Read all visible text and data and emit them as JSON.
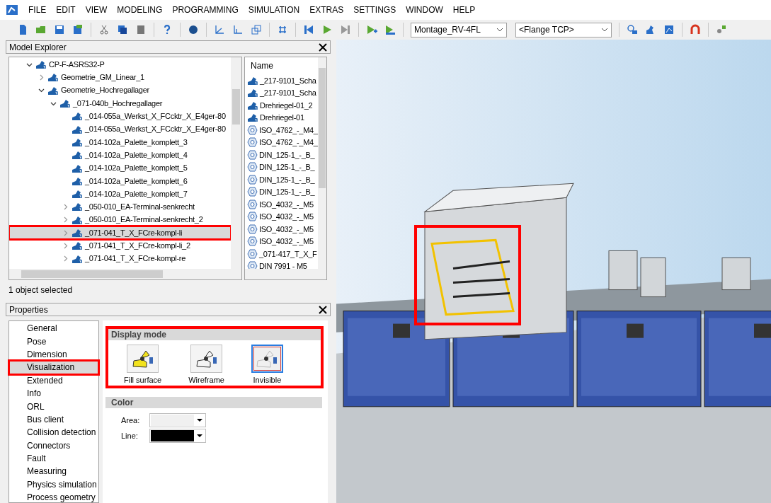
{
  "menu": [
    "FILE",
    "EDIT",
    "VIEW",
    "MODELING",
    "PROGRAMMING",
    "SIMULATION",
    "EXTRAS",
    "SETTINGS",
    "WINDOW",
    "HELP"
  ],
  "toolbar": {
    "robot_select": "Montage_RV-4FL",
    "tcp_select": "<Flange TCP>"
  },
  "model_explorer": {
    "title": "Model Explorer",
    "tree": [
      {
        "label": "CP-F-ASRS32-P",
        "kind": "group",
        "expanded": true,
        "selected": false,
        "children": [
          {
            "label": "Geometrie_GM_Linear_1",
            "kind": "group",
            "expanded": false,
            "selected": false
          },
          {
            "label": "Geometrie_Hochregallager",
            "kind": "group",
            "expanded": true,
            "selected": false,
            "children": [
              {
                "label": "_071-040b_Hochregallager",
                "kind": "group",
                "expanded": true,
                "selected": false,
                "children": [
                  {
                    "label": "_014-055a_Werkst_X_FCcktr_X_E4ger-80",
                    "kind": "leaf",
                    "selected": false
                  },
                  {
                    "label": "_014-055a_Werkst_X_FCcktr_X_E4ger-80",
                    "kind": "leaf",
                    "selected": false
                  },
                  {
                    "label": "_014-102a_Palette_komplett_3",
                    "kind": "leaf",
                    "selected": false
                  },
                  {
                    "label": "_014-102a_Palette_komplett_4",
                    "kind": "leaf",
                    "selected": false
                  },
                  {
                    "label": "_014-102a_Palette_komplett_5",
                    "kind": "leaf",
                    "selected": false
                  },
                  {
                    "label": "_014-102a_Palette_komplett_6",
                    "kind": "leaf",
                    "selected": false
                  },
                  {
                    "label": "_014-102a_Palette_komplett_7",
                    "kind": "leaf",
                    "selected": false
                  },
                  {
                    "label": "_050-010_EA-Terminal-senkrecht",
                    "kind": "group",
                    "expanded": false,
                    "selected": false
                  },
                  {
                    "label": "_050-010_EA-Terminal-senkrecht_2",
                    "kind": "group",
                    "expanded": false,
                    "selected": false
                  },
                  {
                    "label": "_071-041_T_X_FCre-kompl-li",
                    "kind": "group",
                    "expanded": false,
                    "selected": true
                  },
                  {
                    "label": "_071-041_T_X_FCre-kompl-li_2",
                    "kind": "group",
                    "expanded": false,
                    "selected": false
                  },
                  {
                    "label": "_071-041_T_X_FCre-kompl-re",
                    "kind": "group",
                    "expanded": false,
                    "selected": false
                  }
                ]
              }
            ]
          }
        ]
      }
    ],
    "list_header": "Name",
    "list": [
      {
        "label": "_217-9101_Scha",
        "kind": "part"
      },
      {
        "label": "_217-9101_Scha",
        "kind": "part"
      },
      {
        "label": "Drehriegel-01_2",
        "kind": "part"
      },
      {
        "label": "Drehriegel-01",
        "kind": "part"
      },
      {
        "label": "ISO_4762_-_M4_",
        "kind": "screw"
      },
      {
        "label": "ISO_4762_-_M4_",
        "kind": "screw"
      },
      {
        "label": "DIN_125-1_-_B_",
        "kind": "screw"
      },
      {
        "label": "DIN_125-1_-_B_",
        "kind": "screw"
      },
      {
        "label": "DIN_125-1_-_B_",
        "kind": "screw"
      },
      {
        "label": "DIN_125-1_-_B_",
        "kind": "screw"
      },
      {
        "label": "ISO_4032_-_M5",
        "kind": "screw"
      },
      {
        "label": "ISO_4032_-_M5",
        "kind": "screw"
      },
      {
        "label": "ISO_4032_-_M5",
        "kind": "screw"
      },
      {
        "label": "ISO_4032_-_M5",
        "kind": "screw"
      },
      {
        "label": "_071-417_T_X_F",
        "kind": "screw"
      },
      {
        "label": "DIN 7991 - M5",
        "kind": "screw"
      }
    ],
    "status": "1 object selected"
  },
  "properties": {
    "title": "Properties",
    "categories": [
      {
        "label": "General",
        "selected": false
      },
      {
        "label": "Pose",
        "selected": false
      },
      {
        "label": "Dimension",
        "selected": false
      },
      {
        "label": "Visualization",
        "selected": true
      },
      {
        "label": "Extended",
        "selected": false
      },
      {
        "label": "Info",
        "selected": false
      },
      {
        "label": "ORL",
        "selected": false
      },
      {
        "label": "Bus client",
        "selected": false
      },
      {
        "label": "Collision detection",
        "selected": false
      },
      {
        "label": "Connectors",
        "selected": false
      },
      {
        "label": "Fault",
        "selected": false
      },
      {
        "label": "Measuring",
        "selected": false
      },
      {
        "label": "Physics simulation",
        "selected": false
      },
      {
        "label": "Process geometry",
        "selected": false
      }
    ],
    "display_mode": {
      "title": "Display mode",
      "options": [
        {
          "label": "Fill surface",
          "kind": "fill",
          "selected": false
        },
        {
          "label": "Wireframe",
          "kind": "wire",
          "selected": false
        },
        {
          "label": "Invisible",
          "kind": "invisible",
          "selected": true
        }
      ]
    },
    "color": {
      "title": "Color",
      "rows": [
        {
          "label": "Area:",
          "color": "#f0f0f0"
        },
        {
          "label": "Line:",
          "color": "#000000"
        }
      ]
    }
  }
}
